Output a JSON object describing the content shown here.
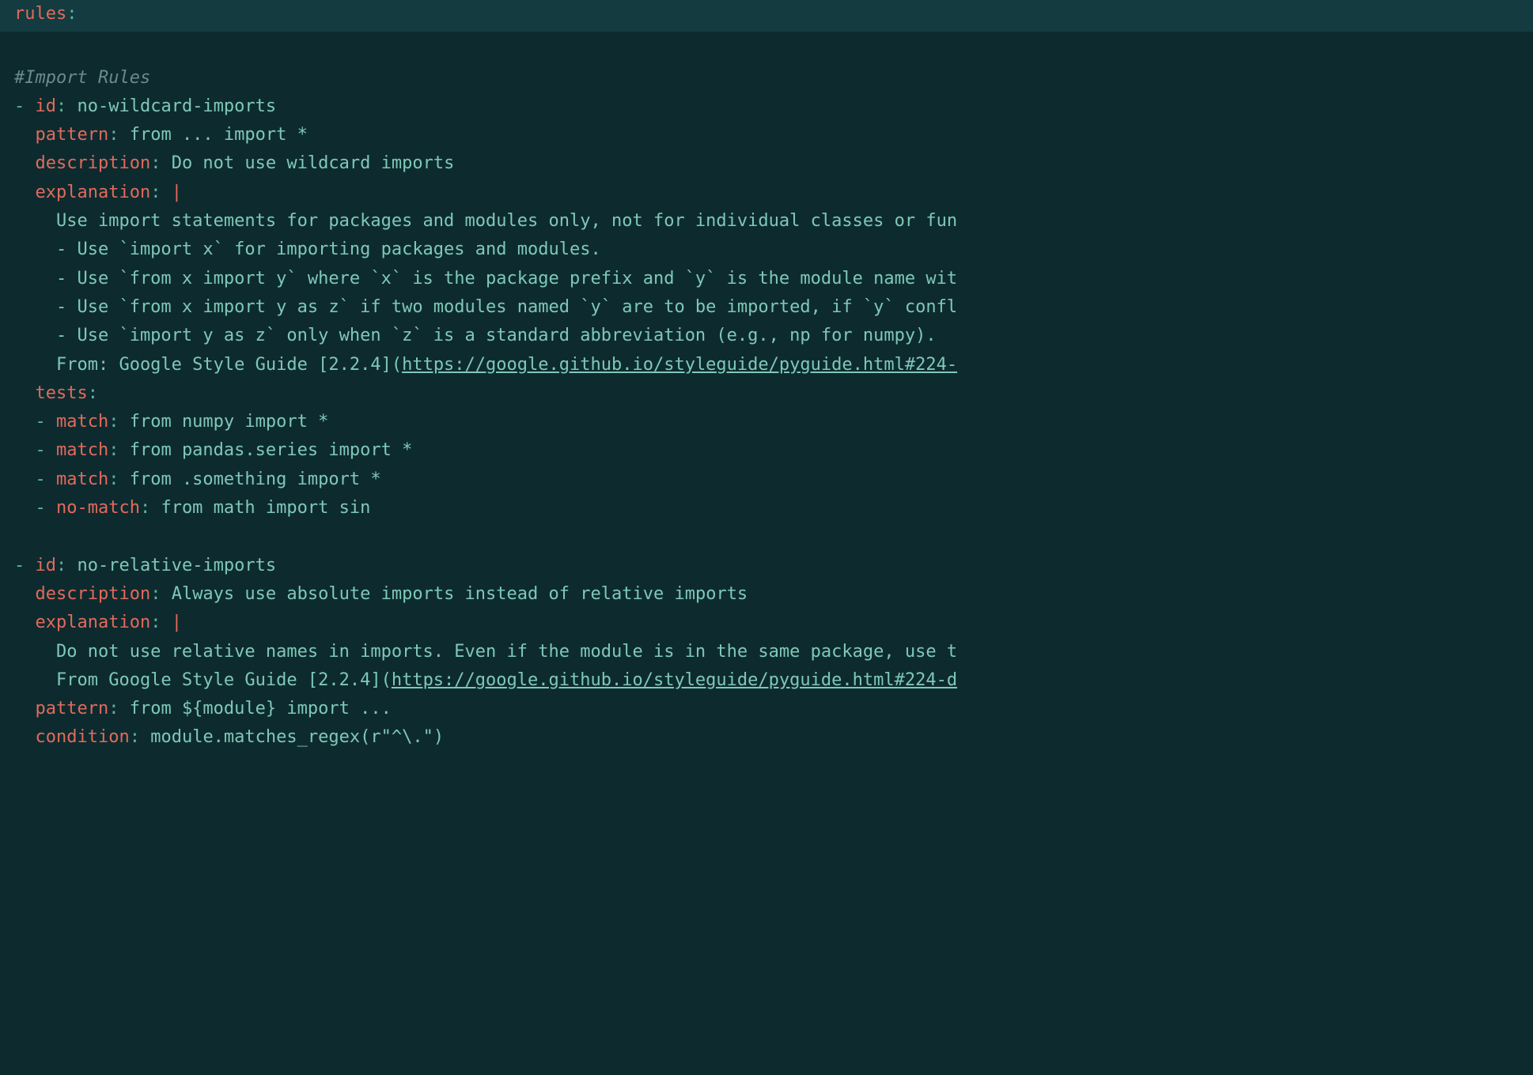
{
  "lines": {
    "l0_key": "rules",
    "l0_colon": ":",
    "comment_import": "#Import Rules",
    "r1_dash": "- ",
    "r1_id_key": "id",
    "r1_id_val": " no-wildcard-imports",
    "r1_pattern_key": "pattern",
    "r1_pattern_val": " from ... import *",
    "r1_desc_key": "description",
    "r1_desc_val": " Do not use wildcard imports",
    "r1_expl_key": "explanation",
    "r1_expl_pipe": " |",
    "r1_e1": "    Use import statements for packages and modules only, not for individual classes or fun",
    "r1_e2": "    - Use `import x` for importing packages and modules.",
    "r1_e3": "    - Use `from x import y` where `x` is the package prefix and `y` is the module name wit",
    "r1_e4": "    - Use `from x import y as z` if two modules named `y` are to be imported, if `y` confl",
    "r1_e5": "    - Use `import y as z` only when `z` is a standard abbreviation (e.g., np for numpy).",
    "r1_e6a": "    From: Google Style Guide [2.2.4](",
    "r1_e6_link": "https://google.github.io/styleguide/pyguide.html#224-",
    "r1_tests_key": "tests",
    "r1_t_dash": "  - ",
    "r1_t1_key": "match",
    "r1_t1_val": " from numpy import *",
    "r1_t2_key": "match",
    "r1_t2_val": " from pandas.series import *",
    "r1_t3_key": "match",
    "r1_t3_val": " from .something import *",
    "r1_t4_key": "no-match",
    "r1_t4_val": " from math import sin",
    "r2_dash": "- ",
    "r2_id_key": "id",
    "r2_id_val": " no-relative-imports",
    "r2_desc_key": "description",
    "r2_desc_val": " Always use absolute imports instead of relative imports",
    "r2_expl_key": "explanation",
    "r2_expl_pipe": " |",
    "r2_e1": "    Do not use relative names in imports. Even if the module is in the same package, use t",
    "r2_e2a": "    From Google Style Guide [2.2.4](",
    "r2_e2_link": "https://google.github.io/styleguide/pyguide.html#224-d",
    "r2_pattern_key": "pattern",
    "r2_pattern_val": " from ${module} import ...",
    "r2_cond_key": "condition",
    "r2_cond_val": " module.matches_regex(r\"^\\.\")"
  }
}
